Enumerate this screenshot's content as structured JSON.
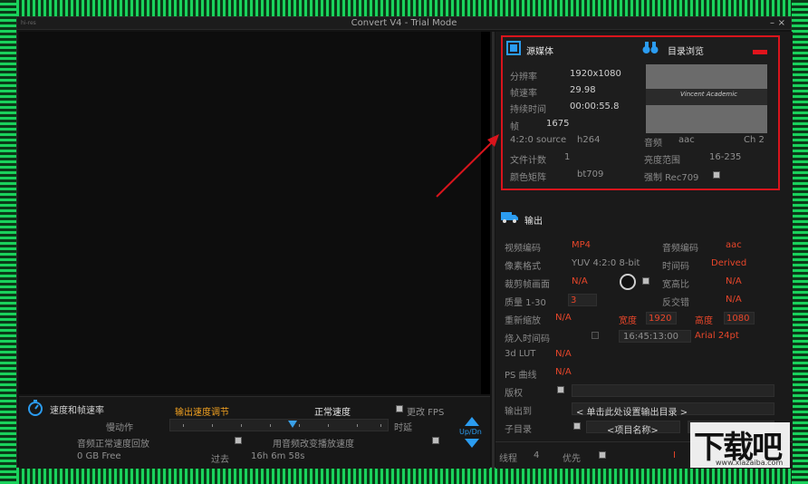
{
  "window": {
    "title": "Convert V4 - Trial Mode",
    "app_icon": "hi-res",
    "minimize": "–",
    "close": "×"
  },
  "source": {
    "title": "源媒体",
    "browser_title": "目录浏览",
    "resolution_label": "分辨率",
    "resolution": "1920x1080",
    "framerate_label": "帧速率",
    "framerate": "29.98",
    "duration_label": "持续时间",
    "duration": "00:00:55.8",
    "frames_label": "帧",
    "frames": "1675",
    "source_fmt": "4:2:0 source",
    "source_codec": "h264",
    "audio_label": "音频",
    "audio": "aac",
    "audio_ch": "Ch 2",
    "file_count_label": "文件计数",
    "file_count": "1",
    "brightness_label": "亮度范围",
    "brightness": "16-235",
    "color_matrix_label": "颜色矩阵",
    "color_matrix": "bt709",
    "force_label": "强制 Rec709",
    "thumb_logo": "Vincent Academic"
  },
  "output": {
    "title": "输出",
    "video_codec_label": "视频编码",
    "video_codec": "MP4",
    "audio_codec_label": "音频编码",
    "audio_codec": "aac",
    "pixel_fmt_label": "像素格式",
    "pixel_fmt": "YUV 4:2:0 8-bit",
    "timecode_label": "时间码",
    "timecode": "Derived",
    "crop_label": "裁剪帧画面",
    "crop": "N/A",
    "aspect_label": "宽高比",
    "aspect": "N/A",
    "quality_label": "质量 1-30",
    "quality": "3",
    "deinterlace_label": "反交错",
    "deinterlace": "N/A",
    "rescale_label": "重新缩放",
    "rescale": "N/A",
    "width_label": "宽度",
    "width": "1920",
    "height_label": "高度",
    "height": "1080",
    "burn_tc_label": "烧入时间码",
    "burn_tc_value": "16:45:13:00",
    "burn_tc_font": "Arial 24pt",
    "lut_label": "3d LUT",
    "lut": "N/A",
    "ps_label": "PS 曲线",
    "ps": "N/A",
    "copyright_label": "版权",
    "output_to_label": "输出到",
    "output_to": "< 单击此处设置输出目录 >",
    "subdir_label": "子目录",
    "subdir": "<项目名称>",
    "threads_label": "线程",
    "threads": "4",
    "priority_label": "优先",
    "priority_marker": "I"
  },
  "speed": {
    "title": "速度和帧速率",
    "adjust_label": "输出速度调节",
    "normal_label": "正常速度",
    "change_fps_label": "更改 FPS",
    "slow_label": "慢动作",
    "delay_label": "时延",
    "audio_normal_label": "音频正常速度回放",
    "audio_change_label": "用音频改变播放速度",
    "free_space": "0 GB Free",
    "past_label": "过去",
    "elapsed": "16h 6m 58s",
    "updn_label": "Up/Dn"
  },
  "watermark": {
    "text": "下载吧",
    "url": "www.xiazaiba.com"
  },
  "colors": {
    "highlight_red": "#d8141c",
    "value_red": "#e8462a",
    "accent_blue": "#2b9cf0",
    "frame_green": "#1ad25c"
  }
}
